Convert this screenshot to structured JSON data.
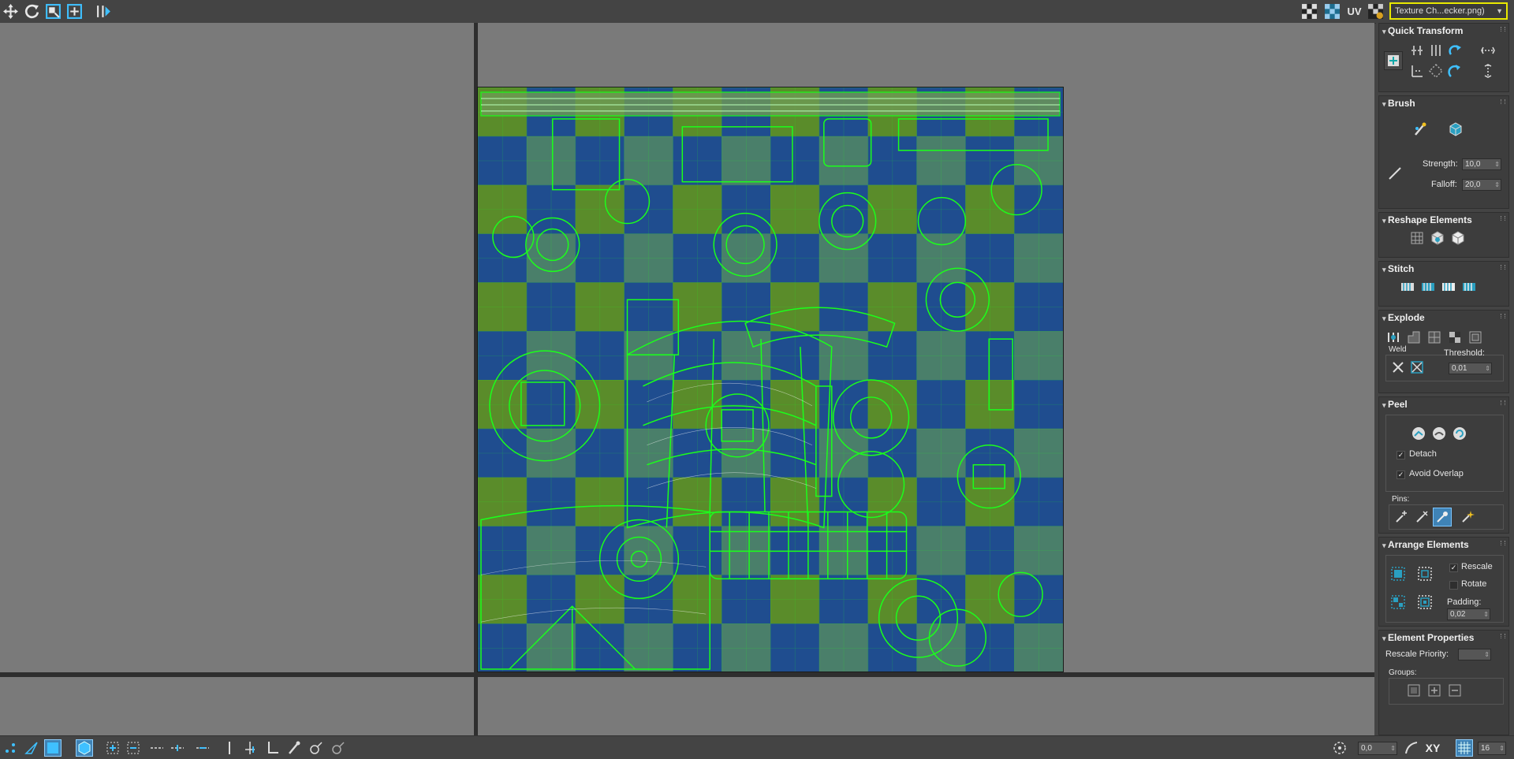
{
  "toolbar": {
    "left_tools": [
      "move-icon",
      "rotate-icon",
      "scale-icon",
      "freeform-icon",
      "mirror-icon"
    ],
    "right_tools": [
      "checker-icon",
      "checker-display-icon"
    ],
    "uv_label": "UV",
    "texture_dropdown": "Texture Ch...ecker.png)"
  },
  "panel": {
    "quick_transform": {
      "title": "Quick Transform"
    },
    "brush": {
      "title": "Brush",
      "strength_label": "Strength:",
      "strength_value": "10,0",
      "falloff_label": "Falloff:",
      "falloff_value": "20,0"
    },
    "reshape": {
      "title": "Reshape Elements"
    },
    "stitch": {
      "title": "Stitch"
    },
    "explode": {
      "title": "Explode",
      "weld_label": "Weld",
      "threshold_label": "Threshold:",
      "threshold_value": "0,01"
    },
    "peel": {
      "title": "Peel",
      "detach_label": "Detach",
      "avoid_overlap_label": "Avoid Overlap",
      "pins_label": "Pins:",
      "check": "✓"
    },
    "arrange": {
      "title": "Arrange Elements",
      "rescale_label": "Rescale",
      "rotate_label": "Rotate",
      "padding_label": "Padding:",
      "padding_value": "0,02",
      "check": "✓"
    },
    "element_props": {
      "title": "Element Properties",
      "rescale_priority_label": "Rescale Priority:",
      "groups_label": "Groups:"
    }
  },
  "statusbar": {
    "value": "0,0",
    "axis_label": "XY",
    "grid_value": "16"
  },
  "colors": {
    "uv_wire": "#1bff1b",
    "checker_a": "#1f4d8f",
    "checker_b": "#5a8c2a",
    "highlight": "#e8e800",
    "accent": "#3f83b6"
  }
}
